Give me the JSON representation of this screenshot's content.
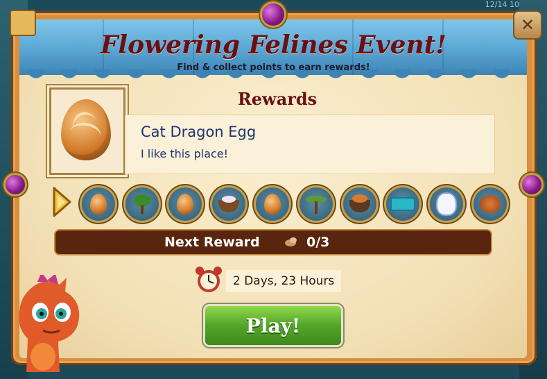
{
  "event": {
    "title": "Flowering Felines Event!",
    "subtitle": "Find & collect points to earn rewards!"
  },
  "rewards": {
    "heading": "Rewards",
    "selected": {
      "name": "Cat Dragon Egg",
      "description": "I like this place!"
    },
    "items": [
      {
        "icon": "egg-icon"
      },
      {
        "icon": "tree-icon"
      },
      {
        "icon": "egg-icon"
      },
      {
        "icon": "nest-icon"
      },
      {
        "icon": "egg-icon"
      },
      {
        "icon": "acacia-tree-icon"
      },
      {
        "icon": "basket-icon"
      },
      {
        "icon": "pool-icon"
      },
      {
        "icon": "unicorn-icon"
      },
      {
        "icon": "armadillo-icon"
      }
    ]
  },
  "progress": {
    "label": "Next Reward",
    "count": "0/3",
    "current": 0,
    "target": 3
  },
  "timer": {
    "text": "2 Days, 23 Hours"
  },
  "play": {
    "label": "Play!"
  },
  "background": {
    "topright_counter": "12/14 10"
  },
  "colors": {
    "title": "#6a0f17",
    "curtain": "#5aa6d3",
    "play_button": "#53a52a",
    "progress_bar": "#5a250e"
  }
}
